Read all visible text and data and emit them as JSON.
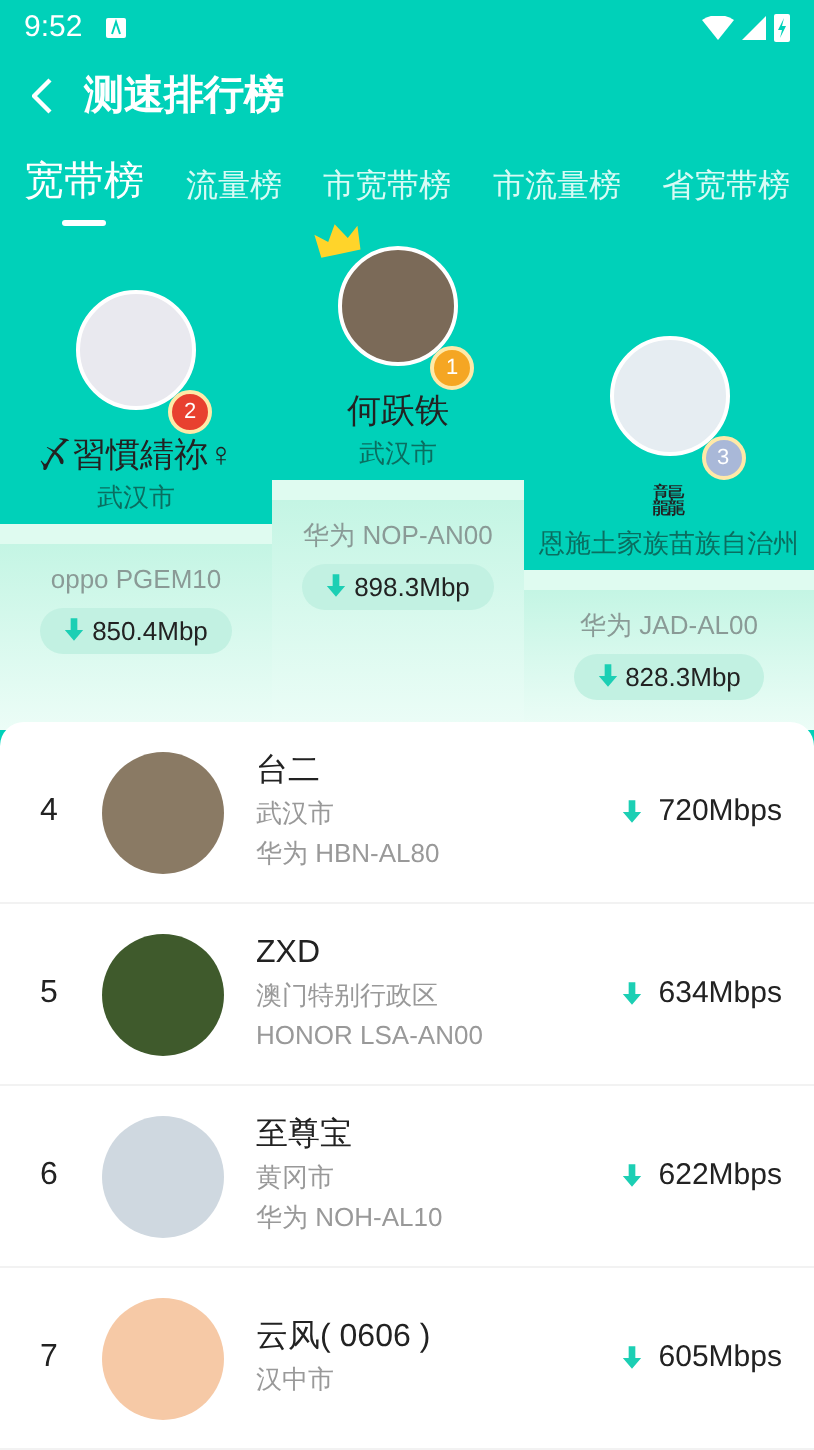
{
  "status_bar": {
    "time": "9:52"
  },
  "header": {
    "title": "测速排行榜"
  },
  "tabs": [
    {
      "label": "宽带榜",
      "selected": true
    },
    {
      "label": "流量榜",
      "selected": false
    },
    {
      "label": "市宽带榜",
      "selected": false
    },
    {
      "label": "市流量榜",
      "selected": false
    },
    {
      "label": "省宽带榜",
      "selected": false
    }
  ],
  "podium": [
    {
      "place": "2",
      "color": "#e8402f",
      "name": "〆習慣綪祢♀",
      "city": "武汉市",
      "device": "oppo PGEM10",
      "speed": "850.4Mbp",
      "crown": false
    },
    {
      "place": "1",
      "color": "#f5a623",
      "name": "何跃铁",
      "city": "武汉市",
      "device": "华为 NOP-AN00",
      "speed": "898.3Mbp",
      "crown": true
    },
    {
      "place": "3",
      "color": "#a9b8d8",
      "name": "龘",
      "city": "恩施土家族苗族自治州",
      "device": "华为 JAD-AL00",
      "speed": "828.3Mbp",
      "crown": false
    }
  ],
  "ranking": [
    {
      "rank": "4",
      "name": "台二",
      "city": "武汉市",
      "device": "华为 HBN-AL80",
      "speed": "720Mbps"
    },
    {
      "rank": "5",
      "name": "ZXD",
      "city": "澳门特别行政区",
      "device": "HONOR LSA-AN00",
      "speed": "634Mbps"
    },
    {
      "rank": "6",
      "name": "至尊宝",
      "city": "黄冈市",
      "device": "华为 NOH-AL10",
      "speed": "622Mbps"
    },
    {
      "rank": "7",
      "name": "云风( 0606 )",
      "city": "汉中市",
      "speed": "605Mbps"
    }
  ]
}
